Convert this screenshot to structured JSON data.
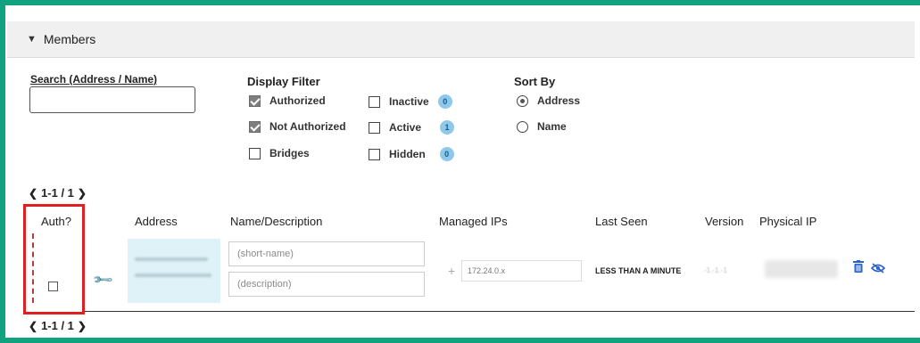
{
  "section": {
    "title": "Members",
    "chevron": "chevron-down-icon"
  },
  "search": {
    "label": "Search (Address / Name)",
    "value": "",
    "placeholder": ""
  },
  "display_filter": {
    "title": "Display Filter",
    "authorized": {
      "label": "Authorized",
      "checked": true
    },
    "not_authorized": {
      "label": "Not Authorized",
      "checked": true
    },
    "bridges": {
      "label": "Bridges",
      "checked": false
    },
    "inactive": {
      "label": "Inactive",
      "checked": false,
      "count": "0"
    },
    "active": {
      "label": "Active",
      "checked": false,
      "count": "1"
    },
    "hidden": {
      "label": "Hidden",
      "checked": false,
      "count": "0"
    }
  },
  "sort_by": {
    "title": "Sort By",
    "options": [
      {
        "label": "Address",
        "selected": true
      },
      {
        "label": "Name",
        "selected": false
      }
    ]
  },
  "pagination": {
    "top": "1-1 / 1",
    "bottom": "1-1 / 1"
  },
  "table": {
    "headers": {
      "auth": "Auth?",
      "address": "Address",
      "name": "Name/Description",
      "managed_ips": "Managed IPs",
      "last_seen": "Last Seen",
      "version": "Version",
      "physical_ip": "Physical IP"
    },
    "rows": [
      {
        "authorized": false,
        "short_name_placeholder": "(short-name)",
        "description_placeholder": "(description)",
        "managed_ip_placeholder": "172.24.0.x",
        "last_seen": "LESS THAN A MINUTE",
        "version": "-1.-1.-1"
      }
    ]
  },
  "colors": {
    "frame": "#11a37f",
    "highlight_box": "#e02020",
    "badge": "#8ec8ea",
    "accent": "#2a63c9"
  }
}
